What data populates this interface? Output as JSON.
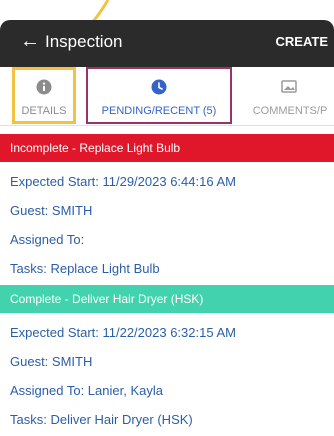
{
  "appbar": {
    "back_icon": "arrow-left-icon",
    "title": "Inspection",
    "action": "CREATE"
  },
  "tabs": [
    {
      "label": "DETAILS",
      "icon": "info-icon"
    },
    {
      "label": "PENDING/RECENT (5)",
      "icon": "clock-icon"
    },
    {
      "label": "COMMENTS/P",
      "icon": "image-icon"
    }
  ],
  "tasks": [
    {
      "status": "Incomplete - Replace Light Bulb",
      "status_color": "#e0172b",
      "expected_start": "Expected Start: 11/29/2023 6:44:16 AM",
      "guest": "Guest: SMITH",
      "assigned": "Assigned To:",
      "tasks": "Tasks: Replace Light Bulb"
    },
    {
      "status": "Complete - Deliver Hair Dryer (HSK)",
      "status_color": "#42d2ad",
      "expected_start": "Expected Start: 11/22/2023 6:32:15 AM",
      "guest": "Guest: SMITH",
      "assigned": "Assigned To: Lanier, Kayla",
      "tasks": "Tasks: Deliver Hair Dryer (HSK)"
    }
  ],
  "colors": {
    "accent": "#3563c9",
    "annotation_yellow": "#f3c242",
    "annotation_pink": "#9a3366"
  }
}
